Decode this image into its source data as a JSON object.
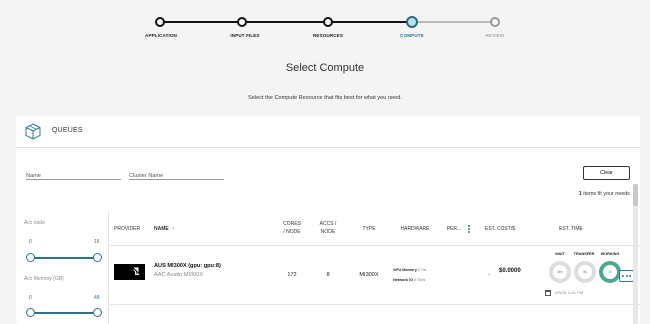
{
  "stepper": {
    "steps": [
      {
        "label": "APPLICATION",
        "state": "done"
      },
      {
        "label": "INPUT FILES",
        "state": "done"
      },
      {
        "label": "RESOURCES",
        "state": "done"
      },
      {
        "label": "COMPUTE",
        "state": "current"
      },
      {
        "label": "REVIEW",
        "state": "future"
      }
    ]
  },
  "header": {
    "title": "Select Compute",
    "subtitle": "Select the Compute Resource that fits best for what you need."
  },
  "queues": {
    "title": "QUEUES",
    "filters": {
      "name_placeholder": "Name",
      "cluster_placeholder": "Cluster Name",
      "clear_label": "Clear"
    },
    "fit": {
      "count": "1",
      "text": " items fit your needs"
    },
    "sliders": [
      {
        "label": "Acc node",
        "min": "0",
        "max": "16"
      },
      {
        "label": "Acc Memory (GB)",
        "min": "0",
        "max": "48"
      }
    ],
    "columns": {
      "provider": "PROVIDER",
      "name": "NAME",
      "name_sort_icon": "arrow-up-icon",
      "cores": "CORES\n/ NODE",
      "accs": "ACCS /\nNODE",
      "type": "TYPE",
      "hardware": "HARDWARE",
      "per": "PER...",
      "cost": "EST. COST/$",
      "time": "EST. TIME"
    },
    "rows": [
      {
        "provider_logo": "amd-logo",
        "name": "AUS MI300X (gpu: gpu:8)",
        "subname": "AAC Austin MI300X",
        "cores": "172",
        "accs": "8",
        "type": "MI300X",
        "hw_gpu_label": "GPU Memory",
        "hw_gpu_value": "0 Gb",
        "hw_net_label": "Network IO",
        "hw_net_value": "0 Gb/s",
        "per": "-",
        "cost": "$0.0000",
        "wait_label": "WAIT",
        "wait_value": "0m",
        "transfer_label": "TRANSFER",
        "transfer_value": "0s",
        "working_label": "WORKING",
        "working_value": "1h",
        "finish_time": "2/5/25, 6:41 PM"
      }
    ]
  },
  "colors": {
    "accent": "#2b7b97",
    "ring_done": "#4aa98f",
    "ring_idle": "#dddddd"
  }
}
